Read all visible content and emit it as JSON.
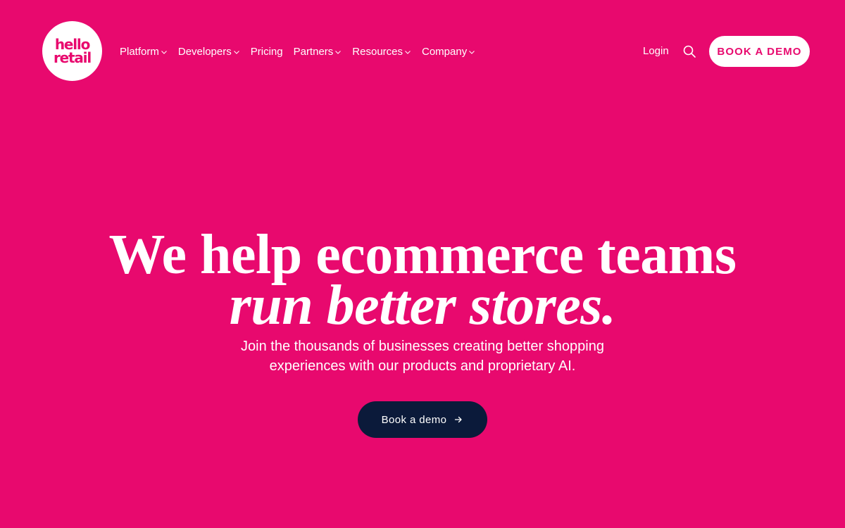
{
  "brand": {
    "logo_line1": "hello",
    "logo_line2": "retail",
    "color_primary": "#e8096e",
    "color_dark": "#0b1a3a"
  },
  "nav": {
    "items": [
      {
        "label": "Platform",
        "has_dropdown": true
      },
      {
        "label": "Developers",
        "has_dropdown": true
      },
      {
        "label": "Pricing",
        "has_dropdown": false
      },
      {
        "label": "Partners",
        "has_dropdown": true
      },
      {
        "label": "Resources",
        "has_dropdown": true
      },
      {
        "label": "Company",
        "has_dropdown": true
      }
    ],
    "login_label": "Login",
    "search_icon": "search-icon",
    "demo_label": "BOOK A DEMO"
  },
  "hero": {
    "title_line1": "We help ecommerce teams",
    "title_line2": "run better stores.",
    "subtitle": "Join the thousands of businesses creating better shopping experiences with our products and proprietary AI.",
    "cta_label": "Book a demo",
    "cta_icon": "arrow-right-icon"
  }
}
